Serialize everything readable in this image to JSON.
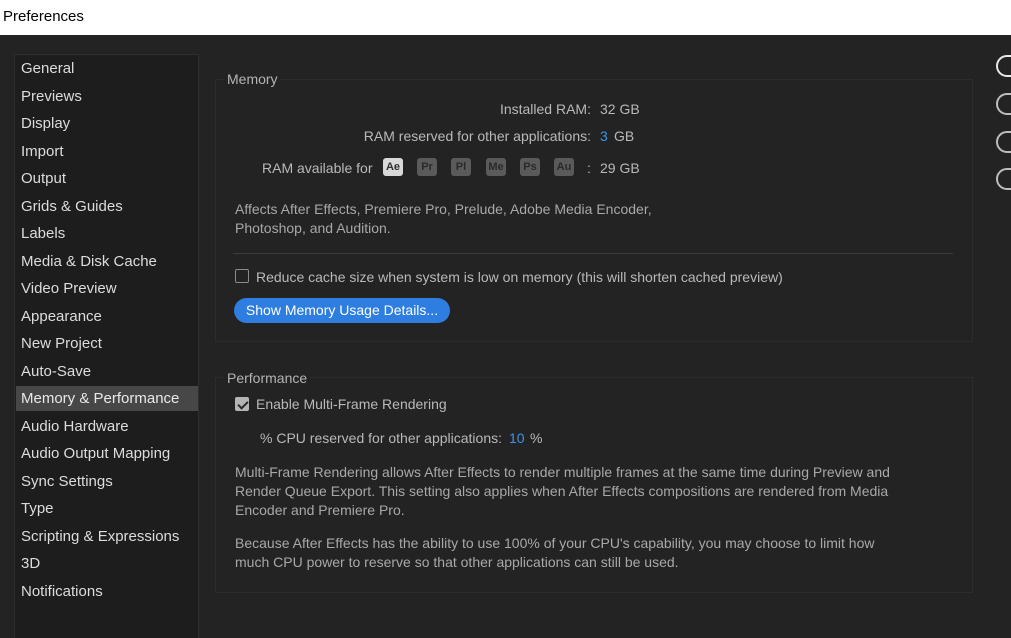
{
  "window": {
    "title": "Preferences"
  },
  "sidebar": {
    "items": [
      {
        "label": "General"
      },
      {
        "label": "Previews"
      },
      {
        "label": "Display"
      },
      {
        "label": "Import"
      },
      {
        "label": "Output"
      },
      {
        "label": "Grids & Guides"
      },
      {
        "label": "Labels"
      },
      {
        "label": "Media & Disk Cache"
      },
      {
        "label": "Video Preview"
      },
      {
        "label": "Appearance"
      },
      {
        "label": "New Project"
      },
      {
        "label": "Auto-Save"
      },
      {
        "label": "Memory & Performance"
      },
      {
        "label": "Audio Hardware"
      },
      {
        "label": "Audio Output Mapping"
      },
      {
        "label": "Sync Settings"
      },
      {
        "label": "Type"
      },
      {
        "label": "Scripting & Expressions"
      },
      {
        "label": "3D"
      },
      {
        "label": "Notifications"
      }
    ],
    "selected": "Memory & Performance"
  },
  "memory": {
    "title": "Memory",
    "installed_label": "Installed RAM:",
    "installed_value": "32 GB",
    "reserved_label": "RAM reserved for other applications:",
    "reserved_value": "3",
    "reserved_unit": "GB",
    "available_label": "RAM available for",
    "apps": [
      "Ae",
      "Pr",
      "Pl",
      "Me",
      "Ps",
      "Au"
    ],
    "available_colon": ":",
    "available_value": "29 GB",
    "affects_line1": "Affects After Effects, Premiere Pro, Prelude, Adobe Media Encoder,",
    "affects_line2": "Photoshop, and Audition.",
    "reduce_cache_label": "Reduce cache size when system is low on memory (this will shorten cached preview)",
    "reduce_cache_checked": false,
    "details_button": "Show Memory Usage Details..."
  },
  "performance": {
    "title": "Performance",
    "mfr_label": "Enable Multi-Frame Rendering",
    "mfr_checked": true,
    "cpu_label": "% CPU reserved for other applications:",
    "cpu_value": "10",
    "cpu_unit": "%",
    "desc1_line1": "Multi-Frame Rendering allows After Effects to render multiple frames at the same time during Preview and",
    "desc1_line2": "Render Queue Export. This setting also applies when After Effects compositions are rendered from Media",
    "desc1_line3": "Encoder and Premiere Pro.",
    "desc2_line1": "Because After Effects has the ability to use 100% of your CPU's capability, you may choose to limit how",
    "desc2_line2": "much CPU power to reserve so that other applications can still be used."
  },
  "colors": {
    "accent": "#2d7ee0",
    "value_blue": "#3b95e6",
    "background": "#232323",
    "sidebar_selected": "#474747"
  }
}
